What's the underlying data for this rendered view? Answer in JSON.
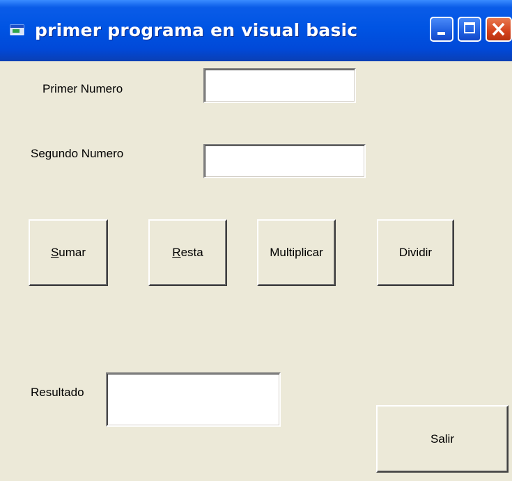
{
  "window": {
    "title": "primer programa en visual basic",
    "icon": "vb-form-icon"
  },
  "form": {
    "primer_label": "Primer Numero",
    "primer_value": "",
    "segundo_label": "Segundo Numero",
    "segundo_value": "",
    "resultado_label": "Resultado",
    "resultado_value": ""
  },
  "buttons": {
    "sumar_mnemonic": "S",
    "sumar_rest": "umar",
    "resta_mnemonic": "R",
    "resta_rest": "esta",
    "multiplicar": "Multiplicar",
    "dividir": "Dividir",
    "salir": "Salir"
  }
}
